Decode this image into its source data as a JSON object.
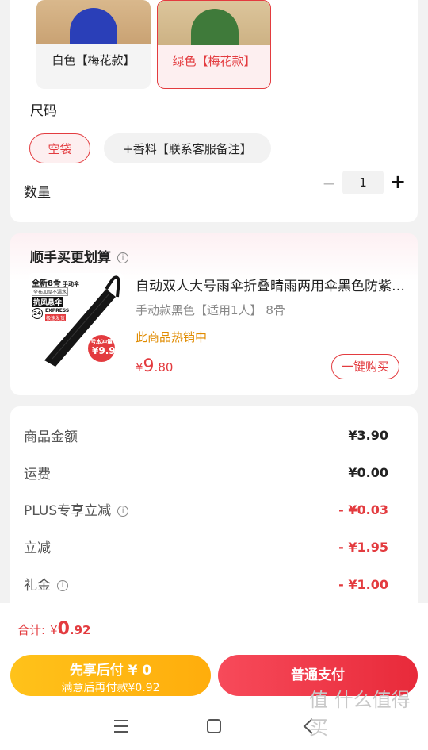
{
  "variants": [
    {
      "label": "白色【梅花款】",
      "selected": false
    },
    {
      "label": "绿色【梅花款】",
      "selected": true
    }
  ],
  "size": {
    "label": "尺码",
    "options": [
      {
        "label": "空袋",
        "selected": true
      },
      {
        "label": "+香料【联系客服备注】",
        "selected": false
      }
    ]
  },
  "quantity": {
    "label": "数量",
    "value": "1",
    "minus": "−",
    "plus": "+"
  },
  "recommend": {
    "title": "顺手买更划算",
    "info_icon": "i",
    "product": {
      "name": "自动双人大号雨伞折叠晴雨两用伞黑色防紫外线",
      "spec": "手动款黑色【适用1人】 8骨",
      "hot_tag": "此商品热销中",
      "price_symbol": "¥",
      "price_int": "9",
      "price_dec": ".80",
      "buy_label": "一键购买",
      "image_text": {
        "line1": "全新8骨",
        "line1_small": "手动伞",
        "line2": "全布加厚不漏水",
        "line3": "抗风悬伞",
        "badge_num": "24",
        "express": "EXPRESS",
        "express_sub": "极速发货",
        "sticker_top": "亏本冲量",
        "sticker_price": "¥9.9"
      }
    }
  },
  "summary": {
    "rows": [
      {
        "label": "商品金额",
        "value": "¥3.90",
        "red": false,
        "info": false
      },
      {
        "label": "运费",
        "value": "¥0.00",
        "red": false,
        "info": false
      },
      {
        "label": "PLUS专享立减",
        "value": "- ¥0.03",
        "red": true,
        "info": true
      },
      {
        "label": "立减",
        "value": "- ¥1.95",
        "red": true,
        "info": false
      },
      {
        "label": "礼金",
        "value": "- ¥1.00",
        "red": true,
        "info": true
      }
    ]
  },
  "footer": {
    "total_label": "合计:",
    "total_symbol": "¥",
    "total_int": "0",
    "total_dec": ".92",
    "pay_later_line1": "先享后付 ¥ 0",
    "pay_later_line2": "满意后再付款¥0.92",
    "pay_normal": "普通支付"
  },
  "watermark": "值 什么值得买",
  "colors": {
    "accent": "#e33b3f",
    "gold": "#ffb515",
    "hot": "#e08b00"
  }
}
